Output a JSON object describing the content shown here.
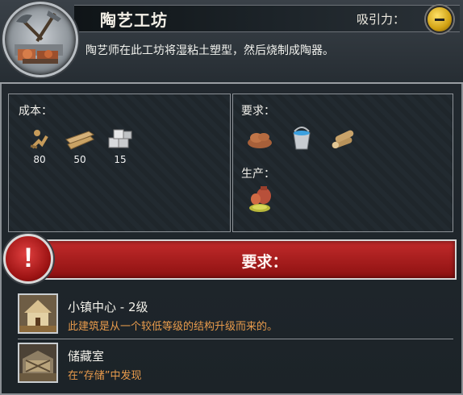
{
  "building": {
    "title": "陶艺工坊",
    "description": "陶艺师在此工坊将湿粘土塑型，然后烧制成陶器。",
    "attraction_label": "吸引力："
  },
  "cost": {
    "label": "成本：",
    "items": [
      {
        "icon": "labor-icon",
        "amount": "80"
      },
      {
        "icon": "wood-planks-icon",
        "amount": "50"
      },
      {
        "icon": "stone-blocks-icon",
        "amount": "15"
      }
    ]
  },
  "requirements": {
    "label": "要求：",
    "items": [
      "clay-icon",
      "water-bucket-icon",
      "firewood-icon"
    ],
    "production_label": "生产：",
    "production": [
      "pottery-icon"
    ]
  },
  "banner": {
    "alert": "!",
    "label": "要求："
  },
  "prereqs": [
    {
      "name": "小镇中心 - 2级",
      "note": "此建筑是从一个较低等级的结构升级而来的。",
      "icon": "town-center-icon"
    },
    {
      "name": "储藏室",
      "note": "在“存储”中发现",
      "icon": "storehouse-icon"
    }
  ],
  "colors": {
    "banner_red": "#b31f1f",
    "note_orange": "#e89b4c",
    "attraction_gold": "#d1a214"
  }
}
